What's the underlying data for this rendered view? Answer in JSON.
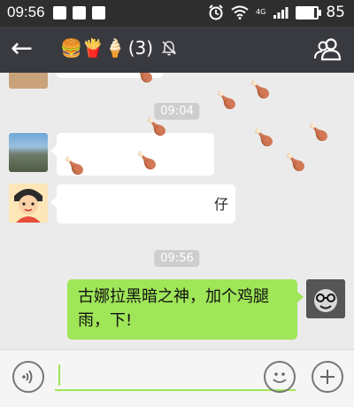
{
  "status_bar": {
    "time": "09:56",
    "network_label": "4G",
    "battery_level": "85",
    "battery_fraction": 0.85
  },
  "header": {
    "title_emojis": "🍔🍟🍦",
    "member_count": "(3)",
    "back_icon": "arrow-left-icon",
    "mute_icon": "bell-off-icon",
    "members_icon": "group-icon"
  },
  "chat": {
    "timestamps": [
      "09:04",
      "09:56"
    ],
    "messages": [
      {
        "sender": "other",
        "text": "仔"
      },
      {
        "sender": "self",
        "text": "古娜拉黑暗之神，加个鸡腿雨，下!"
      }
    ],
    "rain_emoji": "🍗"
  },
  "input": {
    "voice_icon": "voice-icon",
    "emoji_icon": "smiley-icon",
    "plus_icon": "plus-icon"
  },
  "colors": {
    "header_bg": "#393a3f",
    "status_bg": "#2e2e2e",
    "chat_bg": "#ebebeb",
    "self_bubble": "#9fe658",
    "timestamp_bg": "#cecece"
  }
}
